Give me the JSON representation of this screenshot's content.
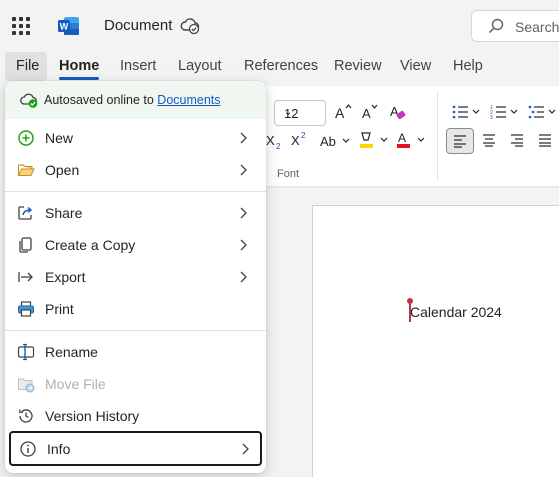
{
  "titlebar": {
    "app_icon": "word-logo",
    "document_title": "Document",
    "cloud_status_icon": "cloud-synced-icon",
    "search_placeholder": "Search"
  },
  "ribbon_tabs": [
    "File",
    "Home",
    "Insert",
    "Layout",
    "References",
    "Review",
    "View",
    "Help"
  ],
  "active_tab": "Home",
  "ribbon": {
    "font_size": "12",
    "font_group_label": "Font"
  },
  "file_menu": {
    "autosave_text": "Autosaved online to",
    "autosave_link": "Documents",
    "items": [
      {
        "label": "New",
        "icon": "plus-circle-icon",
        "submenu": true
      },
      {
        "label": "Open",
        "icon": "folder-open-icon",
        "submenu": true
      },
      {
        "label": "Share",
        "icon": "share-icon",
        "submenu": true
      },
      {
        "label": "Create a Copy",
        "icon": "copy-icon",
        "submenu": true
      },
      {
        "label": "Export",
        "icon": "export-icon",
        "submenu": true
      },
      {
        "label": "Print",
        "icon": "printer-icon",
        "submenu": false
      },
      {
        "label": "Rename",
        "icon": "rename-icon",
        "submenu": false
      },
      {
        "label": "Move File",
        "icon": "move-file-icon",
        "submenu": false,
        "disabled": true
      },
      {
        "label": "Version History",
        "icon": "history-icon",
        "submenu": false
      },
      {
        "label": "Info",
        "icon": "info-icon",
        "submenu": true,
        "focused": true
      }
    ]
  },
  "document": {
    "text": "Calendar 2024"
  },
  "colors": {
    "accent": "#185abd",
    "word_blue": "#185abd",
    "autosave_bg": "#f0f7f0",
    "caret": "#c4314b",
    "font_color_red": "#e81123",
    "highlight_yellow": "#ffd700"
  }
}
